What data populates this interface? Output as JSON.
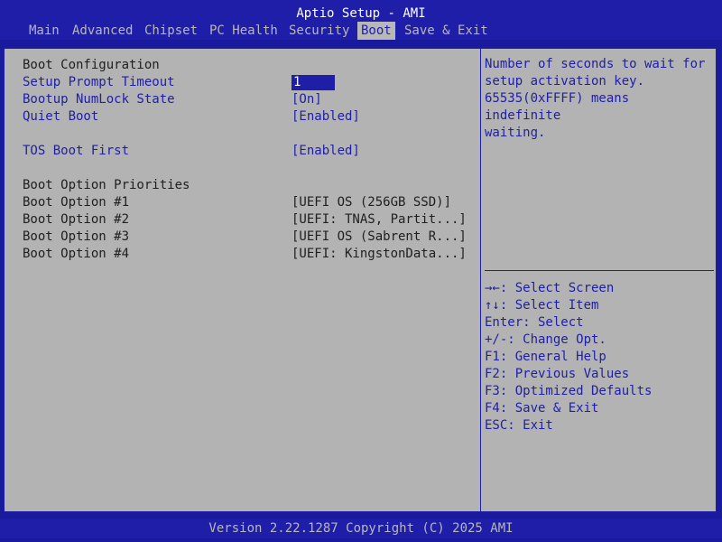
{
  "title": "Aptio Setup - AMI",
  "tabs": [
    "Main",
    "Advanced",
    "Chipset",
    "PC Health",
    "Security",
    "Boot",
    "Save & Exit"
  ],
  "active_tab": "Boot",
  "section_boot_config": "Boot Configuration",
  "settings": [
    {
      "label": "Setup Prompt Timeout",
      "value": "1"
    },
    {
      "label": "Bootup NumLock State",
      "value": "[On]"
    },
    {
      "label": "Quiet Boot",
      "value": "[Enabled]"
    },
    {
      "label": "TOS Boot First",
      "value": "[Enabled]"
    }
  ],
  "section_priorities": "Boot Option Priorities",
  "boot_options": [
    {
      "label": "Boot Option #1",
      "value": "[UEFI OS (256GB SSD)]"
    },
    {
      "label": "Boot Option #2",
      "value": "[UEFI: TNAS, Partit...]"
    },
    {
      "label": "Boot Option #3",
      "value": "[UEFI OS (Sabrent R...]"
    },
    {
      "label": "Boot Option #4",
      "value": "[UEFI: KingstonData...]"
    }
  ],
  "help_text": "Number of seconds to wait for\nsetup activation key.\n65535(0xFFFF) means indefinite\nwaiting.",
  "keys": [
    "→←: Select Screen",
    "↑↓: Select Item",
    "Enter: Select",
    "+/-: Change Opt.",
    "F1: General Help",
    "F2: Previous Values",
    "F3: Optimized Defaults",
    "F4: Save & Exit",
    "ESC: Exit"
  ],
  "footer": "Version 2.22.1287 Copyright (C) 2025 AMI",
  "colors": {
    "background": "#b3b3b3",
    "accent": "#1e1ea8",
    "text": "#202020"
  }
}
